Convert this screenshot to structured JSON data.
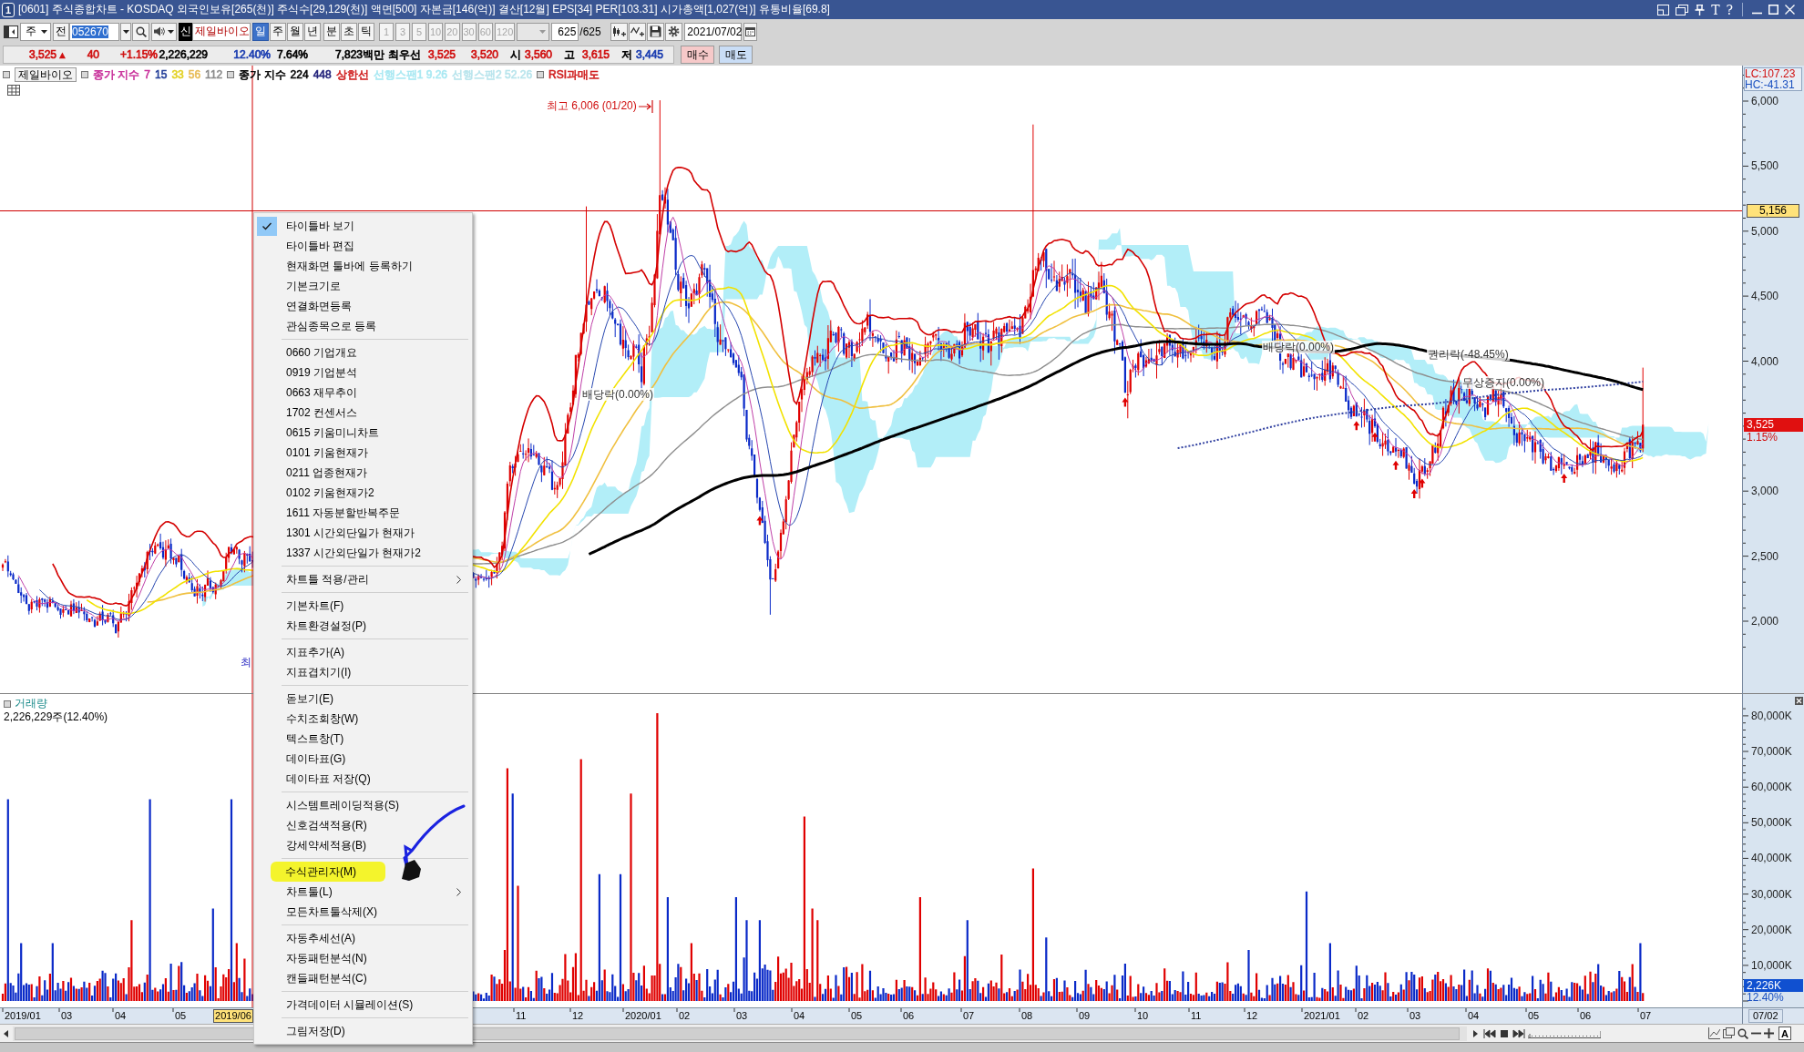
{
  "title_bar": {
    "window_number": "1",
    "title": "[0601] 주식종합차트 - KOSDAQ 외국인보유[265(천)] 주식수[29,129(천)] 액면[500] 자본금[146(억)] 결산[12월] EPS[34] PER[103.31] 시가총액[1,027(억)] 유통비율[69.8]",
    "glyph_buttons": [
      "T",
      "?"
    ]
  },
  "toolbar": {
    "market": "주",
    "prev_button": "전",
    "code": "052670",
    "new_badge": "신",
    "stock_name": "제일바이오",
    "period_groups": [
      {
        "items": [
          {
            "label": "일",
            "selected": true
          },
          {
            "label": "주",
            "selected": false
          },
          {
            "label": "월",
            "selected": false
          },
          {
            "label": "년",
            "selected": false
          }
        ]
      },
      {
        "items": [
          {
            "label": "분",
            "selected": false
          },
          {
            "label": "초",
            "selected": false
          },
          {
            "label": "틱",
            "selected": false
          }
        ]
      }
    ],
    "intervals": [
      {
        "label": "1",
        "disabled": true
      },
      {
        "label": "3",
        "disabled": true
      },
      {
        "label": "5",
        "disabled": true
      },
      {
        "label": "10",
        "disabled": true
      },
      {
        "label": "20",
        "disabled": true
      },
      {
        "label": "30",
        "disabled": true
      },
      {
        "label": "60",
        "disabled": true
      },
      {
        "label": "120",
        "disabled": true
      }
    ],
    "count": "625",
    "count_total": "/625",
    "date": "2021/07/02"
  },
  "quote": {
    "cells": [
      {
        "text": "3,525",
        "color": "#d01010"
      },
      {
        "text": "▲",
        "color": "#d01010"
      },
      {
        "text": "40",
        "color": "#d01010"
      },
      {
        "text": "+1.15%",
        "color": "#d01010"
      },
      {
        "text": "2,226,229",
        "color": "#000000"
      },
      {
        "text": "12.40%",
        "color": "#1a3cb0"
      },
      {
        "text": "7.64%",
        "color": "#000000"
      },
      {
        "text": "7,823백만",
        "color": "#000000"
      },
      {
        "text": "최우선",
        "color": "#000000"
      },
      {
        "text": "3,525",
        "color": "#d01010"
      },
      {
        "text": "3,520",
        "color": "#d01010"
      },
      {
        "text": "시",
        "color": "#000000"
      },
      {
        "text": "3,560",
        "color": "#d01010"
      },
      {
        "text": "고",
        "color": "#000000"
      },
      {
        "text": "3,615",
        "color": "#d01010"
      },
      {
        "text": "저",
        "color": "#000000"
      },
      {
        "text": "3,445",
        "color": "#1a3cb0"
      }
    ],
    "buy_button": "매수",
    "sell_button": "매도"
  },
  "legend": {
    "stock": "제일바이오",
    "groups": [
      {
        "items": [
          {
            "text": "종가 지수",
            "color": "#c8309a"
          },
          {
            "text": "7",
            "color": "#c8309a"
          },
          {
            "text": "15",
            "color": "#26409a"
          },
          {
            "text": "33",
            "color": "#e2d020"
          },
          {
            "text": "56",
            "color": "#e8bc58"
          },
          {
            "text": "112",
            "color": "#8c8c8c"
          }
        ]
      },
      {
        "items": [
          {
            "text": "종가 지수",
            "color": "#000000"
          },
          {
            "text": "224",
            "color": "#000000"
          },
          {
            "text": "448",
            "color": "#22227a"
          },
          {
            "text": "상한선",
            "color": "#d02020"
          },
          {
            "text": "선행스팬1 9.26",
            "color": "#a8e8f2"
          },
          {
            "text": "선행스팬2 52.26",
            "color": "#b8e4ec"
          }
        ]
      },
      {
        "items": [
          {
            "text": "RSI과매도",
            "color": "#d02020"
          }
        ]
      }
    ]
  },
  "price_chart": {
    "indicator_readout": [
      "LC:107.23",
      "HC:-41.31"
    ],
    "high_label": "최고 6,006 (01/20)",
    "events": [
      "배당락(0.00%)",
      "배당락(0.00%)",
      "권리락(-48.45%)",
      "무상증자(0.00%)"
    ],
    "partial_label": "최",
    "axis_labels": [
      "6,000",
      "5,500",
      "5,000",
      "4,500",
      "4,000",
      "3,000",
      "2,500",
      "2,000"
    ],
    "crosshair_price": "5,156",
    "last_price": "3,525",
    "last_change": "1.15%"
  },
  "volume_chart": {
    "title": "거래량",
    "readout": "2,226,229주(12.40%)",
    "axis_labels": [
      "80,000K",
      "70,000K",
      "60,000K",
      "50,000K",
      "40,000K",
      "30,000K",
      "20,000K",
      "10,000K"
    ],
    "last_volume": "2,226K",
    "last_rate": "12.40%"
  },
  "date_axis": {
    "labels": [
      "2019/01",
      "03",
      "04",
      "05",
      "11",
      "12",
      "2020/01",
      "02",
      "03",
      "04",
      "05",
      "06",
      "07",
      "08",
      "09",
      "10",
      "11",
      "12",
      "2021/01",
      "02",
      "03",
      "04",
      "05",
      "06",
      "07"
    ],
    "crosshair_date": "2019/06",
    "last_date": "07/02"
  },
  "context_menu": {
    "groups": [
      {
        "items": [
          {
            "label": "타이틀바 보기",
            "checked": true,
            "submenu": false,
            "highlighted": false
          },
          {
            "label": "타이틀바 편집",
            "checked": false,
            "submenu": false,
            "highlighted": false
          },
          {
            "label": "현재화면 툴바에 등록하기",
            "checked": false,
            "submenu": false,
            "highlighted": false
          },
          {
            "label": "기본크기로",
            "checked": false,
            "submenu": false,
            "highlighted": false
          },
          {
            "label": "연결화면등록",
            "checked": false,
            "submenu": false,
            "highlighted": false
          },
          {
            "label": "관심종목으로 등록",
            "checked": false,
            "submenu": false,
            "highlighted": false
          }
        ]
      },
      {
        "items": [
          {
            "label": "0660 기업개요",
            "checked": false,
            "submenu": false,
            "highlighted": false
          },
          {
            "label": "0919 기업분석",
            "checked": false,
            "submenu": false,
            "highlighted": false
          },
          {
            "label": "0663 재무추이",
            "checked": false,
            "submenu": false,
            "highlighted": false
          },
          {
            "label": "1702 컨센서스",
            "checked": false,
            "submenu": false,
            "highlighted": false
          },
          {
            "label": "0615 키움미니차트",
            "checked": false,
            "submenu": false,
            "highlighted": false
          },
          {
            "label": "0101 키움현재가",
            "checked": false,
            "submenu": false,
            "highlighted": false
          },
          {
            "label": "0211 업종현재가",
            "checked": false,
            "submenu": false,
            "highlighted": false
          },
          {
            "label": "0102 키움현재가2",
            "checked": false,
            "submenu": false,
            "highlighted": false
          },
          {
            "label": "1611 자동분할반복주문",
            "checked": false,
            "submenu": false,
            "highlighted": false
          },
          {
            "label": "1301 시간외단일가 현재가",
            "checked": false,
            "submenu": false,
            "highlighted": false
          },
          {
            "label": "1337 시간외단일가 현재가2",
            "checked": false,
            "submenu": false,
            "highlighted": false
          }
        ]
      },
      {
        "items": [
          {
            "label": "차트틀 적용/관리",
            "checked": false,
            "submenu": true,
            "highlighted": false
          }
        ]
      },
      {
        "items": [
          {
            "label": "기본차트(F)",
            "checked": false,
            "submenu": false,
            "highlighted": false
          },
          {
            "label": "차트환경설정(P)",
            "checked": false,
            "submenu": false,
            "highlighted": false
          }
        ]
      },
      {
        "items": [
          {
            "label": "지표추가(A)",
            "checked": false,
            "submenu": false,
            "highlighted": false
          },
          {
            "label": "지표겹치기(I)",
            "checked": false,
            "submenu": false,
            "highlighted": false
          }
        ]
      },
      {
        "items": [
          {
            "label": "돋보기(E)",
            "checked": false,
            "submenu": false,
            "highlighted": false
          },
          {
            "label": "수치조회창(W)",
            "checked": false,
            "submenu": false,
            "highlighted": false
          },
          {
            "label": "텍스트창(T)",
            "checked": false,
            "submenu": false,
            "highlighted": false
          },
          {
            "label": "데이타표(G)",
            "checked": false,
            "submenu": false,
            "highlighted": false
          },
          {
            "label": "데이타표 저장(Q)",
            "checked": false,
            "submenu": false,
            "highlighted": false
          }
        ]
      },
      {
        "items": [
          {
            "label": "시스템트레이딩적용(S)",
            "checked": false,
            "submenu": false,
            "highlighted": false
          },
          {
            "label": "신호검색적용(R)",
            "checked": false,
            "submenu": false,
            "highlighted": false
          },
          {
            "label": "강세약세적용(B)",
            "checked": false,
            "submenu": false,
            "highlighted": false
          }
        ]
      },
      {
        "items": [
          {
            "label": "수식관리자(M)",
            "checked": false,
            "submenu": false,
            "highlighted": true
          },
          {
            "label": "차트툴(L)",
            "checked": false,
            "submenu": true,
            "highlighted": false
          },
          {
            "label": "모든차트툴삭제(X)",
            "checked": false,
            "submenu": false,
            "highlighted": false
          }
        ]
      },
      {
        "items": [
          {
            "label": "자동추세선(A)",
            "checked": false,
            "submenu": false,
            "highlighted": false
          },
          {
            "label": "자동패턴분석(N)",
            "checked": false,
            "submenu": false,
            "highlighted": false
          },
          {
            "label": "캔들패턴분석(C)",
            "checked": false,
            "submenu": false,
            "highlighted": false
          }
        ]
      },
      {
        "items": [
          {
            "label": "가격데이터 시뮬레이션(S)",
            "checked": false,
            "submenu": false,
            "highlighted": false
          }
        ]
      },
      {
        "items": [
          {
            "label": "그림저장(D)",
            "checked": false,
            "submenu": false,
            "highlighted": false
          }
        ]
      }
    ]
  },
  "scroll_bar": {
    "font_button": "A"
  }
}
